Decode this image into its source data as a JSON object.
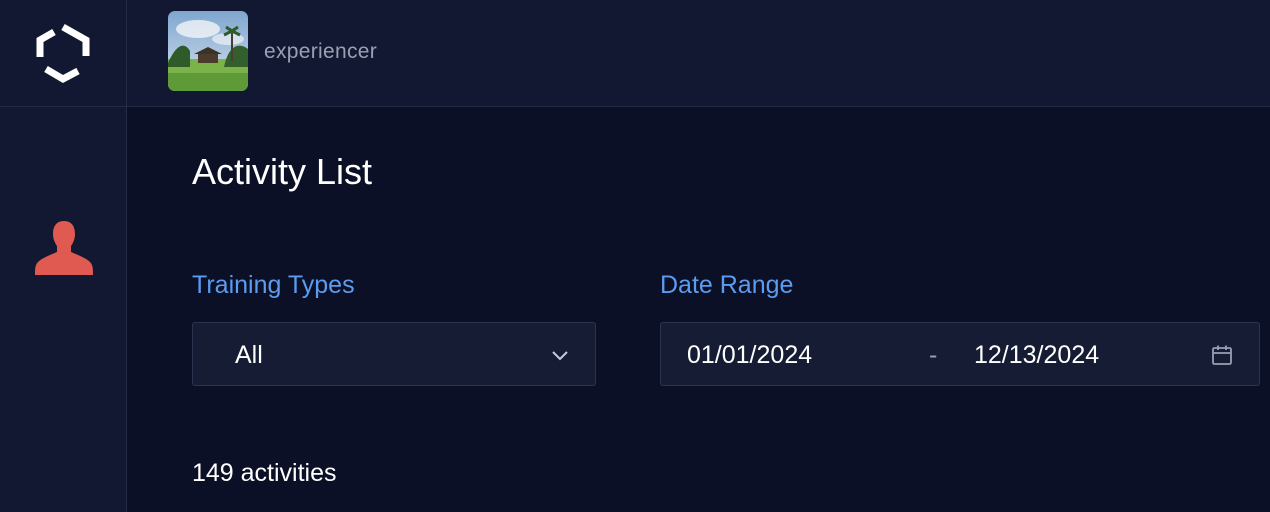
{
  "header": {
    "username": "experiencer"
  },
  "sidebar": {
    "logo_icon": "hexagon-logo-icon",
    "items": [
      {
        "icon": "user-profile-icon",
        "color": "#e05a52"
      }
    ]
  },
  "main": {
    "title": "Activity List",
    "training_types": {
      "label": "Training Types",
      "selected": "All"
    },
    "date_range": {
      "label": "Date Range",
      "start": "01/01/2024",
      "separator": "-",
      "end": "12/13/2024"
    },
    "activity_count": "149 activities"
  },
  "colors": {
    "background": "#0b1026",
    "panel": "#121831",
    "accent": "#5b9cf0",
    "profile_icon": "#e05a52"
  }
}
